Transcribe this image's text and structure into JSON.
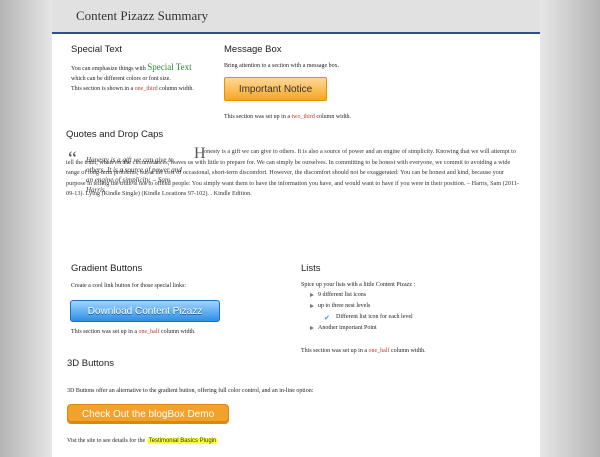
{
  "page": {
    "title": "Content Pizazz Summary"
  },
  "special_text": {
    "heading": "Special Text",
    "line1_pre": "You can emphasize things with ",
    "line1_special": "Special Text",
    "line2": "which can be different colors or font size.",
    "note_pre": "This section is shown in a ",
    "note_code": "one_third",
    "note_post": " column width."
  },
  "message_box": {
    "heading": "Message Box",
    "desc": "Bring attention to a section with a message box.",
    "button_label": "Important Notice",
    "note_pre": "This section was set up in a ",
    "note_code": "two_third",
    "note_post": " column width."
  },
  "quotes": {
    "heading": "Quotes and Drop Caps",
    "quote_mark": "“",
    "pullquote": "Honesty is a gift we can give to others. It is a source of power and an engine of simplicity. – Sam Harris",
    "dropcap": "H",
    "body": "onesty is a gift we can give to others. It is also a source of power and an engine of simplicity. Knowing that we will attempt to tell the truth, whatever the circumstances, leaves us with little to prepare for. We can simply be ourselves. In committing to be honest with everyone, we commit to avoiding a wide range of long-term problems, but at the cost of occasional, short-term discomfort. However, the discomfort should not be exaggerated: You can be honest and kind, because your purpose in telling the truth is not to offend people: You simply want them to have the information you have, and would want to have if you were in their position. – Harris, Sam (2011-09-13). Lying (Kindle Single) (Kindle Locations 97-102). . Kindle Edition."
  },
  "gradient_buttons": {
    "heading": "Gradient Buttons",
    "desc": "Create a cool link button for those special links:",
    "button_label": "Download Content Pizazz",
    "note_pre": "This section was set up in a ",
    "note_code": "one_half",
    "note_post": " column width."
  },
  "lists": {
    "heading": "Lists",
    "desc": "Spice up your lists with a little Content Pizazz :",
    "items": [
      "9 different list icons",
      "up to three nest levels",
      "Different list icon for each level",
      "Another important Point"
    ],
    "note_pre": "This section was set up in a ",
    "note_code": "one_half",
    "note_post": " column width."
  },
  "three_d_buttons": {
    "heading": "3D Buttons",
    "desc": "3D Buttons offer an alternative to the gradient button, offering full color control, and an in-line option:",
    "button_label": "Check Out the blogBox Demo",
    "visit_pre": "Vist the site to see details for the ",
    "visit_link": "Testimonial Basics Plugin"
  },
  "icons": {
    "bullet": "triangle-bullet-icon",
    "check": "check-icon"
  }
}
